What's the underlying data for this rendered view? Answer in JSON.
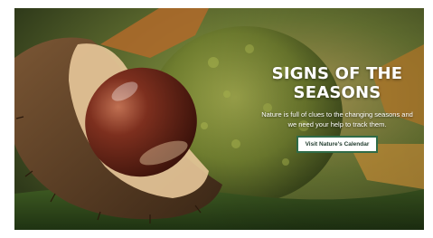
{
  "hero": {
    "headline_line1": "Signs of the",
    "headline_line2": "seasons",
    "subtext_line1": "Nature is full of clues to the changing seasons and",
    "subtext_line2": "we need your help to track them.",
    "cta_label": "Visit Nature's Calendar"
  },
  "colors": {
    "cta_border": "#2f6b47",
    "cta_text": "#1f3a2c"
  },
  "image": {
    "subject": "conker-in-split-husk-photo"
  }
}
